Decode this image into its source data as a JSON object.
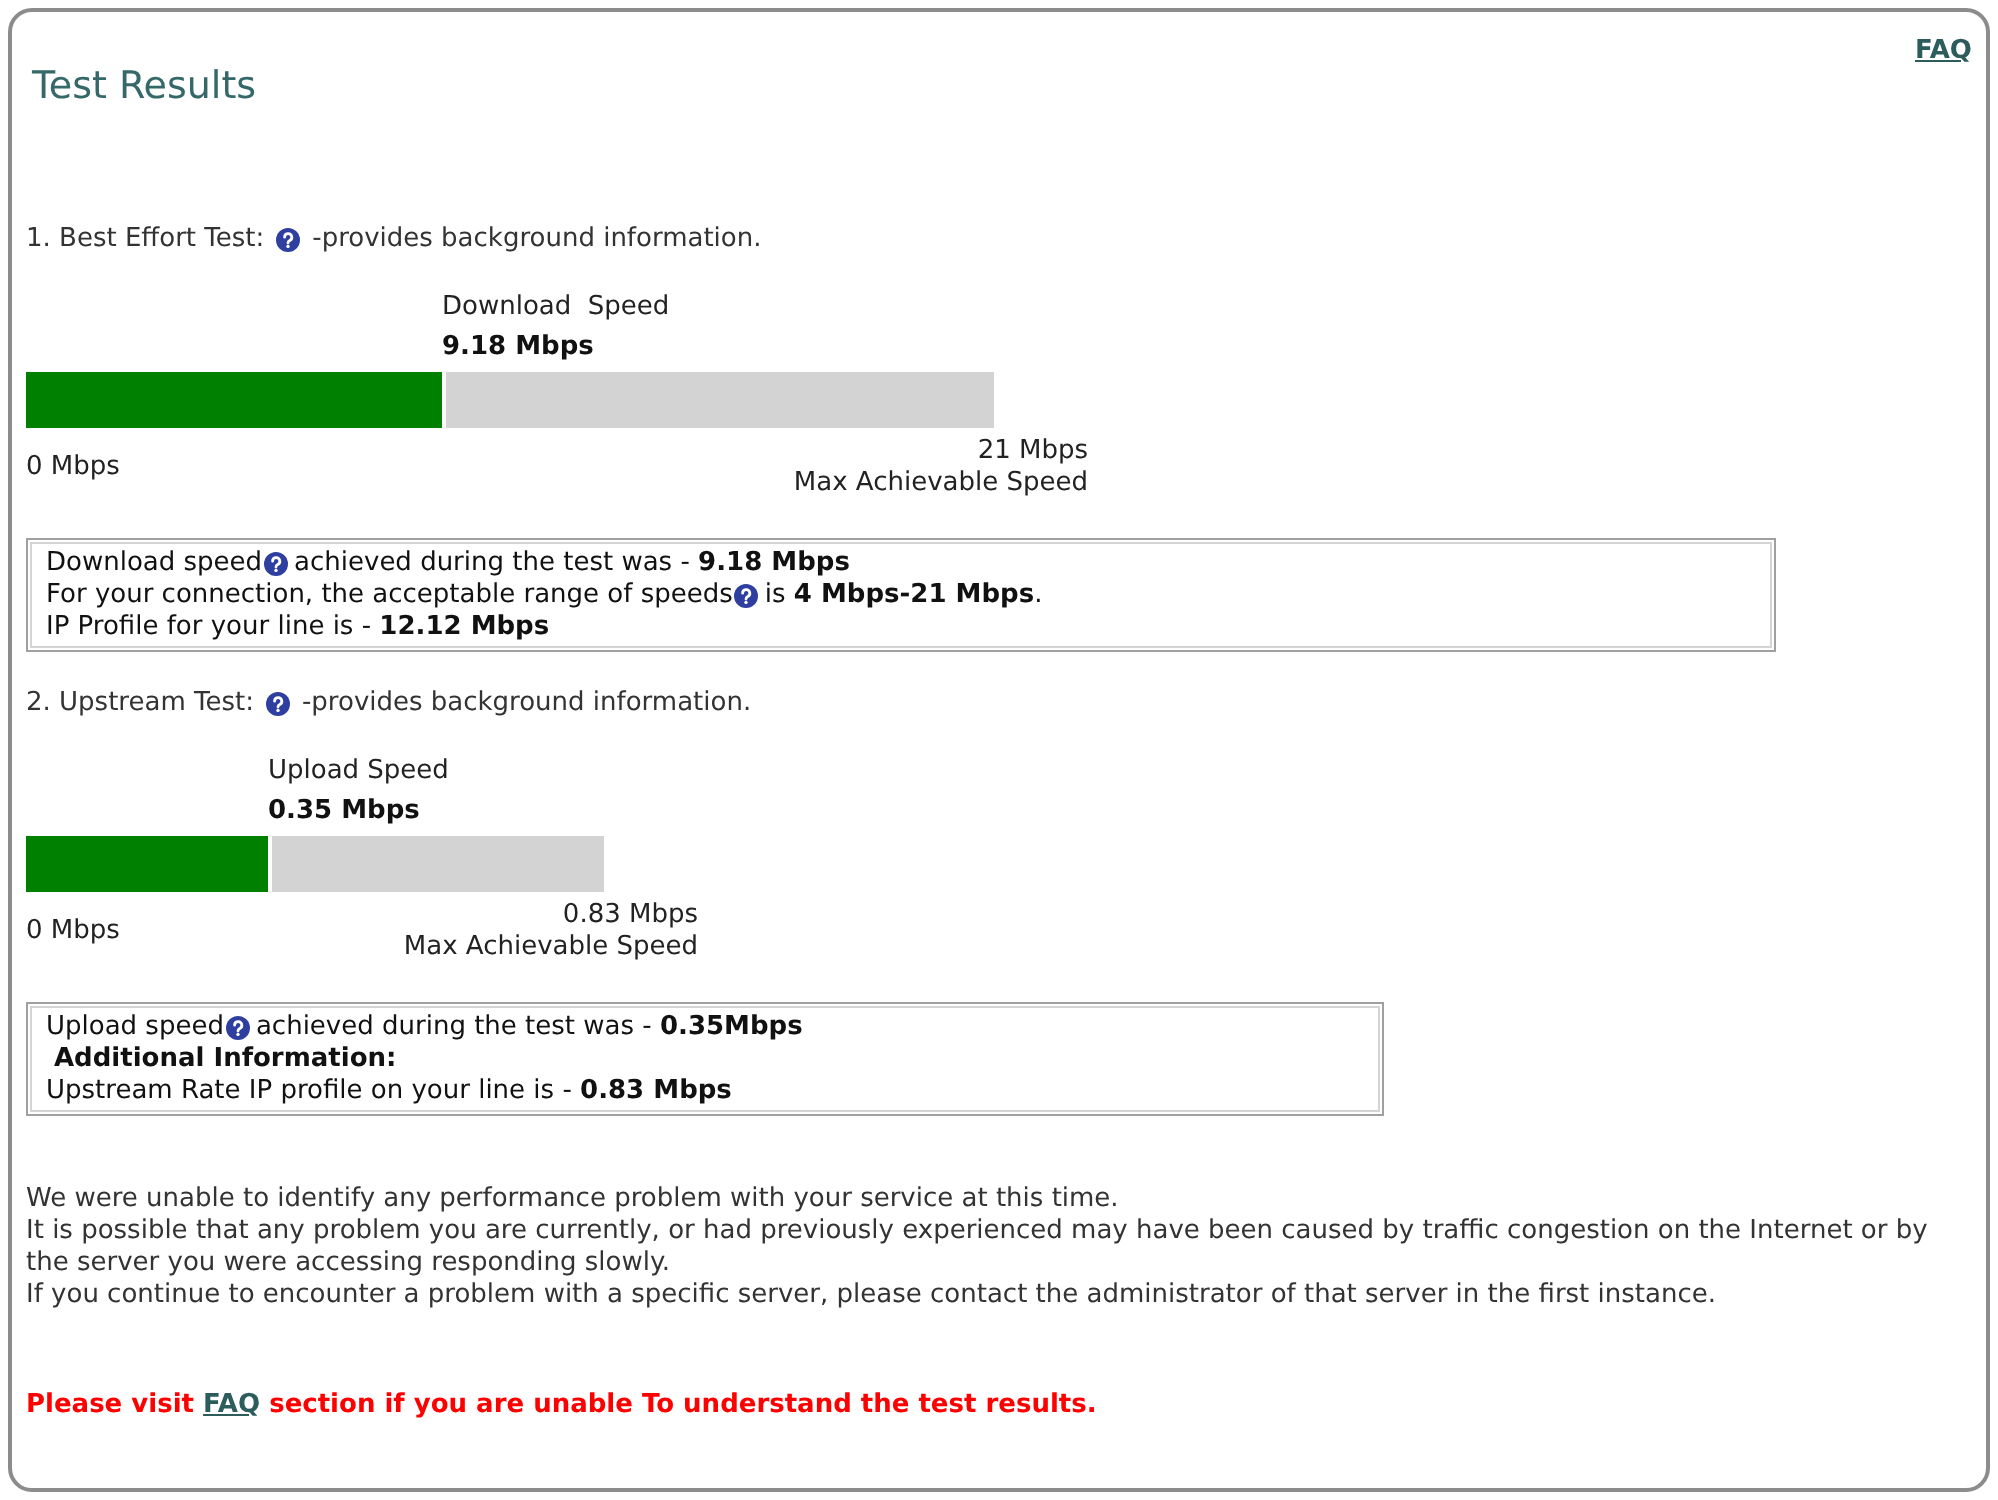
{
  "header": {
    "title": "Test Results",
    "faq_link": "FAQ"
  },
  "tests": [
    {
      "heading": {
        "before": "1. Best Effort Test:",
        "after": "-provides background information."
      },
      "gauge": {
        "kind": "download",
        "label": "Download  Speed",
        "reading": "9.18 Mbps",
        "level": 0.43,
        "min_label": "0 Mbps",
        "max_reading": "21 Mbps",
        "max_label": "Max Achievable Speed"
      },
      "summary": [
        {
          "kind": "help",
          "before": "Download speed",
          "after": "achieved during the test was - **9.18 Mbps**"
        },
        {
          "kind": "help",
          "before": "For your connection, the acceptable range of speeds",
          "after": "is **4 Mbps-21 Mbps**."
        },
        {
          "kind": "plain",
          "text": "IP Profile for your line is - **12.12 Mbps**"
        }
      ]
    },
    {
      "heading": {
        "before": "2. Upstream Test:",
        "after": "-provides background information."
      },
      "gauge": {
        "kind": "upload",
        "label": "Upload Speed",
        "reading": "0.35 Mbps",
        "level": 0.42,
        "min_label": "0 Mbps",
        "max_reading": "0.83 Mbps",
        "max_label": "Max Achievable Speed"
      },
      "summary": [
        {
          "kind": "help",
          "before": "Upload speed",
          "after": "achieved during the test was - **0.35Mbps**"
        },
        {
          "kind": "heading",
          "text": "Additional Information:"
        },
        {
          "kind": "plain",
          "text": "Upstream Rate IP profile on your line is - **0.83 Mbps**"
        }
      ]
    }
  ],
  "notes": [
    "We were unable to identify any performance problem with your service at this time.",
    "It is possible that any problem you are currently, or had previously experienced may have been caused by traffic congestion on the Internet or by the server you were accessing responding slowly.",
    "If you continue to encounter a problem with a specific server, please contact the administrator of that server in the first instance."
  ],
  "footer": {
    "before": "Please visit",
    "link": "FAQ",
    "after": "section if you are unable To understand the test results."
  }
}
